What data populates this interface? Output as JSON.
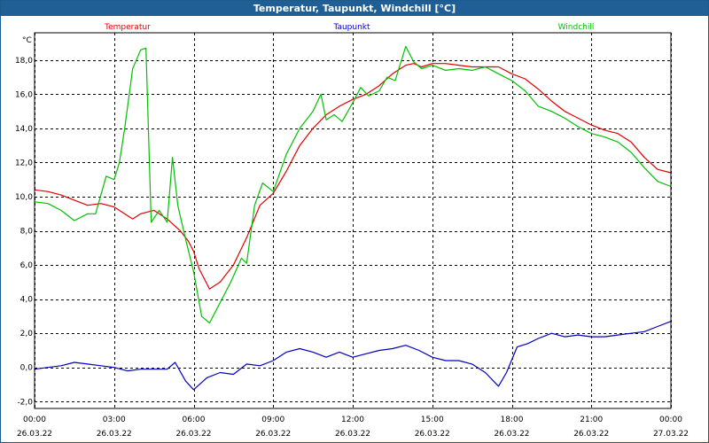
{
  "window": {
    "title": "Temperatur, Taupunkt, Windchill [°C]"
  },
  "chart_data": {
    "type": "line",
    "title": "Temperatur, Taupunkt, Windchill [°C]",
    "ylabel": "°C",
    "xlim_hours": [
      0,
      24
    ],
    "ylim": [
      -2.4,
      19.6
    ],
    "y_ticks": [
      -2.0,
      0.0,
      2.0,
      4.0,
      6.0,
      8.0,
      10.0,
      12.0,
      14.0,
      16.0,
      18.0
    ],
    "y_tick_labels": [
      "-2,0",
      "0,0",
      "2,0",
      "4,0",
      "6,0",
      "8,0",
      "10,0",
      "12,0",
      "14,0",
      "16,0",
      "18,0"
    ],
    "x_ticks": [
      {
        "hour": 0,
        "time": "00:00",
        "date": "26.03.22"
      },
      {
        "hour": 3,
        "time": "03:00",
        "date": "26.03.22"
      },
      {
        "hour": 6,
        "time": "06:00",
        "date": "26.03.22"
      },
      {
        "hour": 9,
        "time": "09:00",
        "date": "26.03.22"
      },
      {
        "hour": 12,
        "time": "12:00",
        "date": "26.03.22"
      },
      {
        "hour": 15,
        "time": "15:00",
        "date": "26.03.22"
      },
      {
        "hour": 18,
        "time": "18:00",
        "date": "26.03.22"
      },
      {
        "hour": 21,
        "time": "21:00",
        "date": "26.03.22"
      },
      {
        "hour": 24,
        "time": "00:00",
        "date": "27.03.22"
      }
    ],
    "grid": true,
    "legend_placement": "top",
    "series": [
      {
        "name": "Temperatur",
        "color": "#e00000",
        "x": [
          0,
          0.5,
          1,
          1.5,
          2,
          2.5,
          3,
          3.3,
          3.7,
          4,
          4.5,
          5,
          5.5,
          5.8,
          6,
          6.2,
          6.6,
          7,
          7.5,
          8,
          8.5,
          9,
          9.5,
          10,
          10.5,
          11,
          11.5,
          12,
          12.5,
          13,
          13.5,
          14,
          14.3,
          14.6,
          15,
          15.5,
          16,
          16.5,
          17,
          17.5,
          18,
          18.5,
          19,
          19.5,
          20,
          20.5,
          21,
          21.5,
          22,
          22.5,
          23,
          23.5,
          24
        ],
        "y": [
          10.4,
          10.3,
          10.1,
          9.8,
          9.5,
          9.6,
          9.4,
          9.1,
          8.7,
          9.0,
          9.2,
          8.7,
          8.0,
          7.4,
          6.8,
          5.8,
          4.6,
          5.0,
          6.0,
          7.6,
          9.5,
          10.2,
          11.5,
          13.0,
          14.0,
          14.8,
          15.3,
          15.7,
          16.0,
          16.5,
          17.2,
          17.7,
          17.8,
          17.6,
          17.8,
          17.8,
          17.7,
          17.6,
          17.6,
          17.6,
          17.2,
          16.9,
          16.3,
          15.6,
          15.0,
          14.6,
          14.2,
          13.9,
          13.7,
          13.2,
          12.3,
          11.6,
          11.4
        ]
      },
      {
        "name": "Taupunkt",
        "color": "#0000c0",
        "x": [
          0,
          0.5,
          1,
          1.5,
          2,
          2.5,
          3,
          3.5,
          4,
          4.5,
          5,
          5.3,
          5.7,
          6,
          6.5,
          7,
          7.5,
          8,
          8.5,
          9,
          9.5,
          10,
          10.5,
          11,
          11.5,
          12,
          12.5,
          13,
          13.5,
          14,
          14.5,
          15,
          15.5,
          16,
          16.5,
          17,
          17.5,
          17.8,
          18.2,
          18.6,
          19,
          19.5,
          20,
          20.5,
          21,
          21.5,
          22,
          22.5,
          23,
          23.5,
          24
        ],
        "y": [
          -0.1,
          0.0,
          0.1,
          0.3,
          0.2,
          0.1,
          0.0,
          -0.2,
          -0.1,
          -0.1,
          -0.1,
          0.3,
          -0.8,
          -1.3,
          -0.6,
          -0.3,
          -0.4,
          0.2,
          0.1,
          0.4,
          0.9,
          1.1,
          0.9,
          0.6,
          0.9,
          0.6,
          0.8,
          1.0,
          1.1,
          1.3,
          1.0,
          0.6,
          0.4,
          0.4,
          0.2,
          -0.3,
          -1.1,
          -0.3,
          1.2,
          1.4,
          1.7,
          2.0,
          1.8,
          1.9,
          1.8,
          1.8,
          1.9,
          2.0,
          2.1,
          2.4,
          2.7
        ]
      },
      {
        "name": "Windchill",
        "color": "#00c000",
        "x": [
          0,
          0.5,
          1,
          1.5,
          2,
          2.3,
          2.7,
          3,
          3.2,
          3.4,
          3.7,
          4,
          4.2,
          4.4,
          4.7,
          5,
          5.2,
          5.4,
          5.7,
          6,
          6.3,
          6.6,
          7,
          7.4,
          7.8,
          8,
          8.3,
          8.6,
          9,
          9.5,
          10,
          10.5,
          10.8,
          11,
          11.3,
          11.6,
          12,
          12.3,
          12.6,
          13,
          13.3,
          13.6,
          14,
          14.3,
          14.6,
          15,
          15.5,
          16,
          16.5,
          17,
          17.5,
          18,
          18.5,
          19,
          19.5,
          20,
          20.5,
          21,
          21.5,
          22,
          22.5,
          23,
          23.5,
          24
        ],
        "y": [
          9.7,
          9.6,
          9.2,
          8.6,
          9.0,
          9.0,
          11.2,
          11.0,
          12.0,
          14.0,
          17.5,
          18.6,
          18.7,
          8.5,
          9.2,
          8.5,
          12.3,
          9.5,
          7.5,
          5.6,
          3.0,
          2.6,
          3.8,
          5.0,
          6.4,
          6.1,
          9.5,
          10.8,
          10.3,
          12.5,
          14.0,
          15.0,
          16.0,
          14.5,
          14.8,
          14.4,
          15.5,
          16.4,
          15.9,
          16.2,
          17.0,
          16.8,
          18.8,
          17.9,
          17.5,
          17.7,
          17.4,
          17.5,
          17.4,
          17.6,
          17.2,
          16.8,
          16.2,
          15.3,
          15.0,
          14.6,
          14.1,
          13.7,
          13.5,
          13.2,
          12.6,
          11.7,
          10.9,
          10.6
        ]
      }
    ]
  }
}
